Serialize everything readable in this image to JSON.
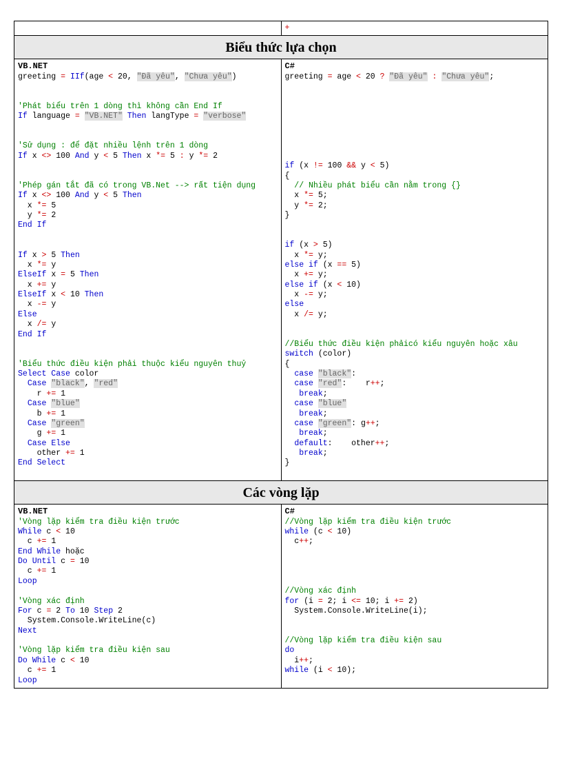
{
  "topRow": {
    "left": "",
    "right": "+"
  },
  "section1": {
    "title": "Biểu thức lựa chọn",
    "leftLang": "VB.NET",
    "rightLang": "C#",
    "vb": {
      "l1a": "greeting ",
      "l1b": "= ",
      "l1c": "IIf",
      "l1d": "(age ",
      "l1e": "<",
      "l1f": " 20, ",
      "l1g": "\"Đã yêu\"",
      "l1h": ", ",
      "l1i": "\"Chưa yêu\"",
      "l1j": ")",
      "c1": "'Phát biểu trên 1 dòng thì không cần End If",
      "l2a": "If",
      "l2b": " language ",
      "l2c": "=",
      "l2d": " ",
      "l2e": "\"VB.NET\"",
      "l2f": " ",
      "l2g": "Then",
      "l2h": " langType ",
      "l2i": "=",
      "l2j": " ",
      "l2k": "\"verbose\"",
      "c2": "'Sử dụng : để đặt nhiều lệnh trên 1 dòng",
      "l3a": "If",
      "l3b": " x ",
      "l3c": "<>",
      "l3d": " 100 ",
      "l3e": "And",
      "l3f": " y ",
      "l3g": "<",
      "l3h": " 5 ",
      "l3i": "Then",
      "l3j": " x ",
      "l3k": "*=",
      "l3l": " 5 ",
      "l3m": ":",
      "l3n": " y ",
      "l3o": "*=",
      "l3p": " 2",
      "c3": "'Phép gán tắt đã có trong VB.Net --> rất tiện dụng",
      "l4a": "If",
      "l4b": " x ",
      "l4c": "<>",
      "l4d": " 100 ",
      "l4e": "And",
      "l4f": " y ",
      "l4g": "<",
      "l4h": " 5 ",
      "l4i": "Then",
      "l5a": "  x ",
      "l5b": "*=",
      "l5c": " 5",
      "l6a": "  y ",
      "l6b": "*=",
      "l6c": " 2",
      "l7": "End If",
      "l8a": "If",
      "l8b": " x ",
      "l8c": ">",
      "l8d": " 5 ",
      "l8e": "Then",
      "l9a": "  x ",
      "l9b": "*=",
      "l9c": " y",
      "l10a": "ElseIf",
      "l10b": " x ",
      "l10c": "=",
      "l10d": " 5 ",
      "l10e": "Then",
      "l11a": "  x ",
      "l11b": "+=",
      "l11c": " y",
      "l12a": "ElseIf",
      "l12b": " x ",
      "l12c": "<",
      "l12d": " 10 ",
      "l12e": "Then",
      "l13a": "  x ",
      "l13b": "-=",
      "l13c": " y",
      "l14": "Else",
      "l15a": "  x ",
      "l15b": "/=",
      "l15c": " y",
      "l16": "End If",
      "c4": "'Biểu thức điều kiện phải thuộc kiểu nguyên thuỷ",
      "l17a": "Select Case",
      "l17b": " color",
      "l18a": "  ",
      "l18b": "Case",
      "l18c": " ",
      "l18d": "\"black\"",
      "l18e": ", ",
      "l18f": "\"red\"",
      "l19a": "    r ",
      "l19b": "+=",
      "l19c": " 1",
      "l20a": "  ",
      "l20b": "Case",
      "l20c": " ",
      "l20d": "\"blue\"",
      "l21a": "    b ",
      "l21b": "+=",
      "l21c": " 1",
      "l22a": "  ",
      "l22b": "Case",
      "l22c": " ",
      "l22d": "\"green\"",
      "l23a": "    g ",
      "l23b": "+=",
      "l23c": " 1",
      "l24a": "  ",
      "l24b": "Case Else",
      "l25a": "    other ",
      "l25b": "+=",
      "l25c": " 1",
      "l26": "End Select"
    },
    "cs": {
      "l1a": "greeting ",
      "l1b": "=",
      "l1c": " age ",
      "l1d": "<",
      "l1e": " 20 ",
      "l1f": "?",
      "l1g": " ",
      "l1h": "\"Đã yêu\"",
      "l1i": " ",
      "l1j": ":",
      "l1k": " ",
      "l1l": "\"Chưa yêu\"",
      "l1m": ";",
      "l2a": "if",
      "l2b": " (x ",
      "l2c": "!=",
      "l2d": " 100 ",
      "l2e": "&&",
      "l2f": " y ",
      "l2g": "<",
      "l2h": " 5)",
      "l3": "{",
      "c1": "  // Nhiều phát biểu cần nằm trong {}",
      "l4a": "  x ",
      "l4b": "*=",
      "l4c": " 5;",
      "l5a": "  y ",
      "l5b": "*=",
      "l5c": " 2;",
      "l6": "}",
      "l7a": "if",
      "l7b": " (x ",
      "l7c": ">",
      "l7d": " 5)",
      "l8a": "  x ",
      "l8b": "*=",
      "l8c": " y;",
      "l9a": "else if",
      "l9b": " (x ",
      "l9c": "==",
      "l9d": " 5)",
      "l10a": "  x ",
      "l10b": "+=",
      "l10c": " y;",
      "l11a": "else if",
      "l11b": " (x ",
      "l11c": "<",
      "l11d": " 10)",
      "l12a": "  x ",
      "l12b": "-=",
      "l12c": " y;",
      "l13": "else",
      "l14a": "  x ",
      "l14b": "/=",
      "l14c": " y;",
      "c2": "//Biểu thức điều kiện phảicó kiểu nguyên hoặc xâu",
      "l15a": "switch",
      "l15b": " (color)",
      "l16": "{",
      "l17a": "  ",
      "l17b": "case",
      "l17c": " ",
      "l17d": "\"black\"",
      "l17e": ":",
      "l18a": "  ",
      "l18b": "case",
      "l18c": " ",
      "l18d": "\"red\"",
      "l18e": ":    r",
      "l18f": "++",
      "l18g": ";",
      "l19a": "   ",
      "l19b": "break",
      "l19c": ";",
      "l20a": "  ",
      "l20b": "case",
      "l20c": " ",
      "l20d": "\"blue\"",
      "l21a": "   ",
      "l21b": "break",
      "l21c": ";",
      "l22a": "  ",
      "l22b": "case",
      "l22c": " ",
      "l22d": "\"green\"",
      "l22e": ": g",
      "l22f": "++",
      "l22g": ";",
      "l23a": "   ",
      "l23b": "break",
      "l23c": ";",
      "l24a": "  ",
      "l24b": "default",
      "l24c": ":    other",
      "l24d": "++",
      "l24e": ";",
      "l25a": "   ",
      "l25b": "break",
      "l25c": ";",
      "l26": "}"
    }
  },
  "section2": {
    "title": "Các vòng lặp",
    "leftLang": "VB.NET",
    "rightLang": "C#",
    "vb": {
      "c1": "'Vòng lặp kiểm tra điều kiện trước",
      "l1a": "While",
      "l1b": " c ",
      "l1c": "<",
      "l1d": " 10",
      "l2a": "  c ",
      "l2b": "+=",
      "l2c": " 1",
      "l3a": "End While",
      "l3b": " hoặc",
      "l4a": "Do Until",
      "l4b": " c ",
      "l4c": "=",
      "l4d": " 10",
      "l5a": "  c ",
      "l5b": "+=",
      "l5c": " 1",
      "l6": "Loop",
      "c2": "'Vòng xác định",
      "l7a": "For",
      "l7b": " c ",
      "l7c": "=",
      "l7d": " 2 ",
      "l7e": "To",
      "l7f": " 10 ",
      "l7g": "Step",
      "l7h": " 2",
      "l8": "  System.Console.WriteLine(c)",
      "l9": "Next",
      "c3": "'Vòng lặp kiểm tra điều kiện sau",
      "l10a": "Do While",
      "l10b": " c ",
      "l10c": "<",
      "l10d": " 10",
      "l11a": "  c ",
      "l11b": "+=",
      "l11c": " 1",
      "l12": "Loop"
    },
    "cs": {
      "c1": "//Vòng lặp kiểm tra điều kiện trước",
      "l1a": "while",
      "l1b": " (c ",
      "l1c": "<",
      "l1d": " 10)",
      "l2a": "  c",
      "l2b": "++",
      "l2c": ";",
      "c2": "//Vòng xác định",
      "l3a": "for",
      "l3b": " (i ",
      "l3c": "=",
      "l3d": " 2; i ",
      "l3e": "<=",
      "l3f": " 10; i ",
      "l3g": "+=",
      "l3h": " 2)",
      "l4": "  System.Console.WriteLine(i);",
      "c3": "//Vòng lặp kiểm tra điều kiện sau",
      "l5": "do",
      "l6a": "  i",
      "l6b": "++",
      "l6c": ";",
      "l7a": "while",
      "l7b": " (i ",
      "l7c": "<",
      "l7d": " 10);"
    }
  }
}
